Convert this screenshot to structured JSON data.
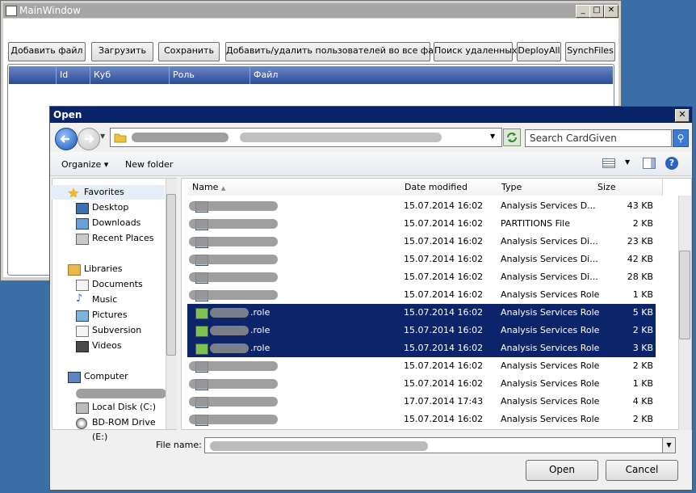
{
  "main_window": {
    "title": "MainWindow",
    "minimize": "_",
    "maximize": "□",
    "close": "✕",
    "toolbar": [
      "Добавить файл",
      "Загрузить",
      "Сохранить",
      "Добавить/удалить пользователей во все файлы",
      "Поиск удаленных",
      "DeployAll",
      "SynchFiles"
    ],
    "grid_columns": [
      "Id",
      "Куб",
      "Роль",
      "Файл"
    ]
  },
  "dialog": {
    "title": "Open",
    "close": "✕",
    "search_placeholder": "Search CardGiven",
    "organize": "Organize",
    "new_folder": "New folder",
    "nav": {
      "favorites": "Favorites",
      "favorite_items": [
        "Desktop",
        "Downloads",
        "Recent Places"
      ],
      "libraries": "Libraries",
      "library_items": [
        "Documents",
        "Music",
        "Pictures",
        "Subversion",
        "Videos"
      ],
      "computer": "Computer",
      "computer_items": [
        "Local Disk (C:)",
        "BD-ROM Drive (E:)"
      ]
    },
    "columns": {
      "name": "Name",
      "date": "Date modified",
      "type": "Type",
      "size": "Size"
    },
    "rows": [
      {
        "name": "",
        "date": "15.07.2014 16:02",
        "type": "Analysis Services D...",
        "size": "43 KB"
      },
      {
        "name": "",
        "date": "15.07.2014 16:02",
        "type": "PARTITIONS File",
        "size": "2 KB"
      },
      {
        "name": "",
        "date": "15.07.2014 16:02",
        "type": "Analysis Services Di...",
        "size": "23 KB"
      },
      {
        "name": "",
        "date": "15.07.2014 16:02",
        "type": "Analysis Services Di...",
        "size": "42 KB"
      },
      {
        "name": "",
        "date": "15.07.2014 16:02",
        "type": "Analysis Services Di...",
        "size": "28 KB"
      },
      {
        "name": "",
        "date": "15.07.2014 16:02",
        "type": "Analysis Services Role",
        "size": "1 KB"
      },
      {
        "name": ".role",
        "date": "15.07.2014 16:02",
        "type": "Analysis Services Role",
        "size": "5 KB"
      },
      {
        "name": ".role",
        "date": "15.07.2014 16:02",
        "type": "Analysis Services Role",
        "size": "2 KB"
      },
      {
        "name": ".role",
        "date": "15.07.2014 16:02",
        "type": "Analysis Services Role",
        "size": "3 KB"
      },
      {
        "name": "",
        "date": "15.07.2014 16:02",
        "type": "Analysis Services Role",
        "size": "2 KB"
      },
      {
        "name": "",
        "date": "15.07.2014 16:02",
        "type": "Analysis Services Role",
        "size": "1 KB"
      },
      {
        "name": "",
        "date": "17.07.2014 17:43",
        "type": "Analysis Services Role",
        "size": "4 KB"
      },
      {
        "name": "",
        "date": "15.07.2014 16:02",
        "type": "Analysis Services Role",
        "size": "2 KB"
      }
    ],
    "file_name_label": "File name:",
    "open": "Open",
    "cancel": "Cancel"
  }
}
